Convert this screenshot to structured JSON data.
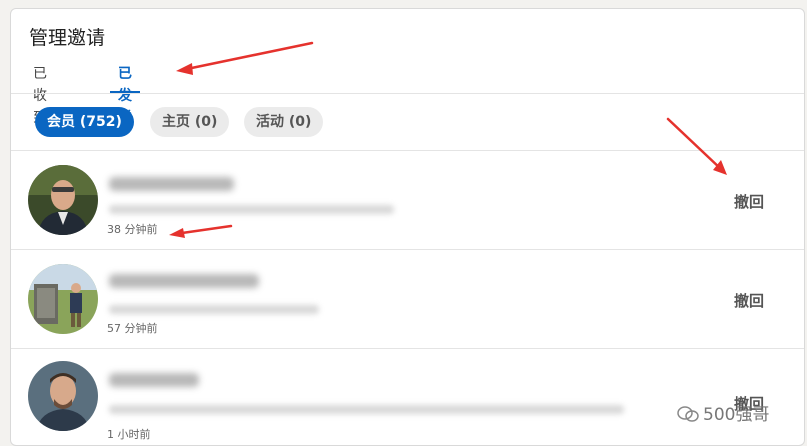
{
  "header": {
    "title": "管理邀请"
  },
  "tabs": [
    {
      "label": "已收到",
      "active": false
    },
    {
      "label": "已发送",
      "active": true
    }
  ],
  "filters": [
    {
      "label": "会员 (752)",
      "active": true
    },
    {
      "label": "主页 (0)",
      "active": false
    },
    {
      "label": "活动 (0)",
      "active": false
    }
  ],
  "invitations": [
    {
      "time": "38 分钟前",
      "action": "撤回"
    },
    {
      "time": "57 分钟前",
      "action": "撤回"
    },
    {
      "time": "1 小时前",
      "action": "撤回"
    }
  ],
  "watermark": {
    "text": "500强哥"
  },
  "colors": {
    "accent": "#0a66c2",
    "annotation_arrow": "#e5322d"
  }
}
